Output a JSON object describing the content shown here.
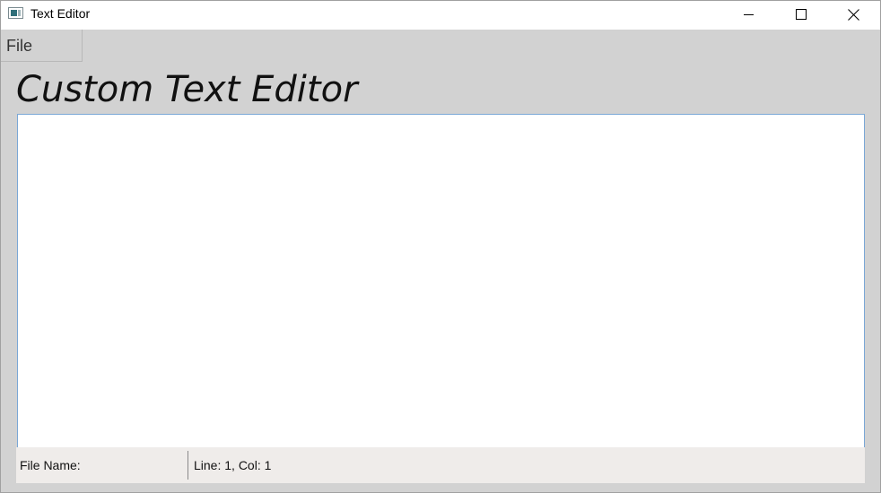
{
  "window": {
    "title": "Text Editor",
    "icon": "app-window-icon",
    "controls": {
      "minimize_icon": "minimize-icon",
      "maximize_icon": "maximize-icon",
      "close_icon": "close-icon"
    }
  },
  "menu": {
    "items": [
      {
        "label": "File"
      }
    ]
  },
  "main": {
    "heading": "Custom Text Editor",
    "editor": {
      "value": "",
      "placeholder": ""
    }
  },
  "status": {
    "file_name": "File Name:",
    "position": "Line: 1, Col: 1"
  },
  "colors": {
    "window_bg": "#d2d2d2",
    "titlebar_bg": "#ffffff",
    "editor_border": "#7aa7d6",
    "statusbar_bg": "#efecea"
  }
}
